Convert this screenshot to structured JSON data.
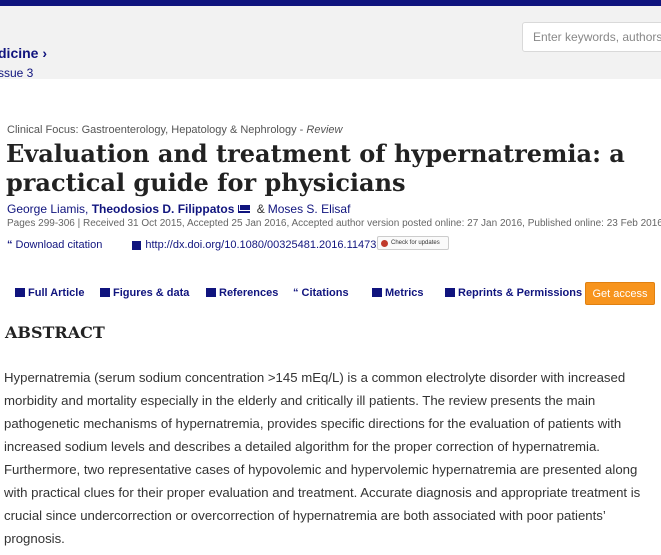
{
  "header": {
    "journal": "dicine ›",
    "issue": "ssue 3",
    "search_placeholder": "Enter keywords, authors, DO"
  },
  "article": {
    "category": "Clinical Focus: Gastroenterology, Hepatology & Nephrology - ",
    "category_type": "Review",
    "title": "Evaluation and treatment of hypernatremia: a practical guide for physicians",
    "authors": [
      "George Liamis,",
      "Theodosios D. Filippatos",
      "Moses S. Elisaf"
    ],
    "authors_amp": "&",
    "pages_info": "Pages 299-306 | Received 31 Oct 2015, Accepted 25 Jan 2016, Accepted author version posted online: 27 Jan 2016, Published online: 23 Feb 2016",
    "download_citation": "Download citation",
    "doi": "http://dx.doi.org/10.1080/00325481.2016.1147322",
    "check_updates": "Check for updates"
  },
  "tabs": [
    {
      "label": "Full Article",
      "icon": "document-icon"
    },
    {
      "label": "Figures & data",
      "icon": "image-icon"
    },
    {
      "label": "References",
      "icon": "book-icon"
    },
    {
      "label": "Citations",
      "icon": "quote-icon"
    },
    {
      "label": "Metrics",
      "icon": "bar-chart-icon"
    },
    {
      "label": "Reprints & Permissions",
      "icon": "printer-icon"
    }
  ],
  "get_access": "Get access",
  "abstract": {
    "heading": "ABSTRACT",
    "text": "Hypernatremia (serum sodium concentration >145 mEq/L) is a common electrolyte disorder with increased morbidity and mortality especially in the elderly and critically ill patients. The review presents the main pathogenetic mechanisms of hypernatremia, provides specific directions for the evaluation of patients with increased sodium levels and describes a detailed algorithm for the proper correction of hypernatremia. Furthermore, two representative cases of hypovolemic and hypervolemic hypernatremia are presented along with practical clues for their proper evaluation and treatment. Accurate diagnosis and appropriate treatment is crucial since undercorrection or overcorrection of hypernatremia are both associated with poor patients’ prognosis."
  },
  "colors": {
    "brand": "#10147e",
    "accent": "#f7941d"
  }
}
